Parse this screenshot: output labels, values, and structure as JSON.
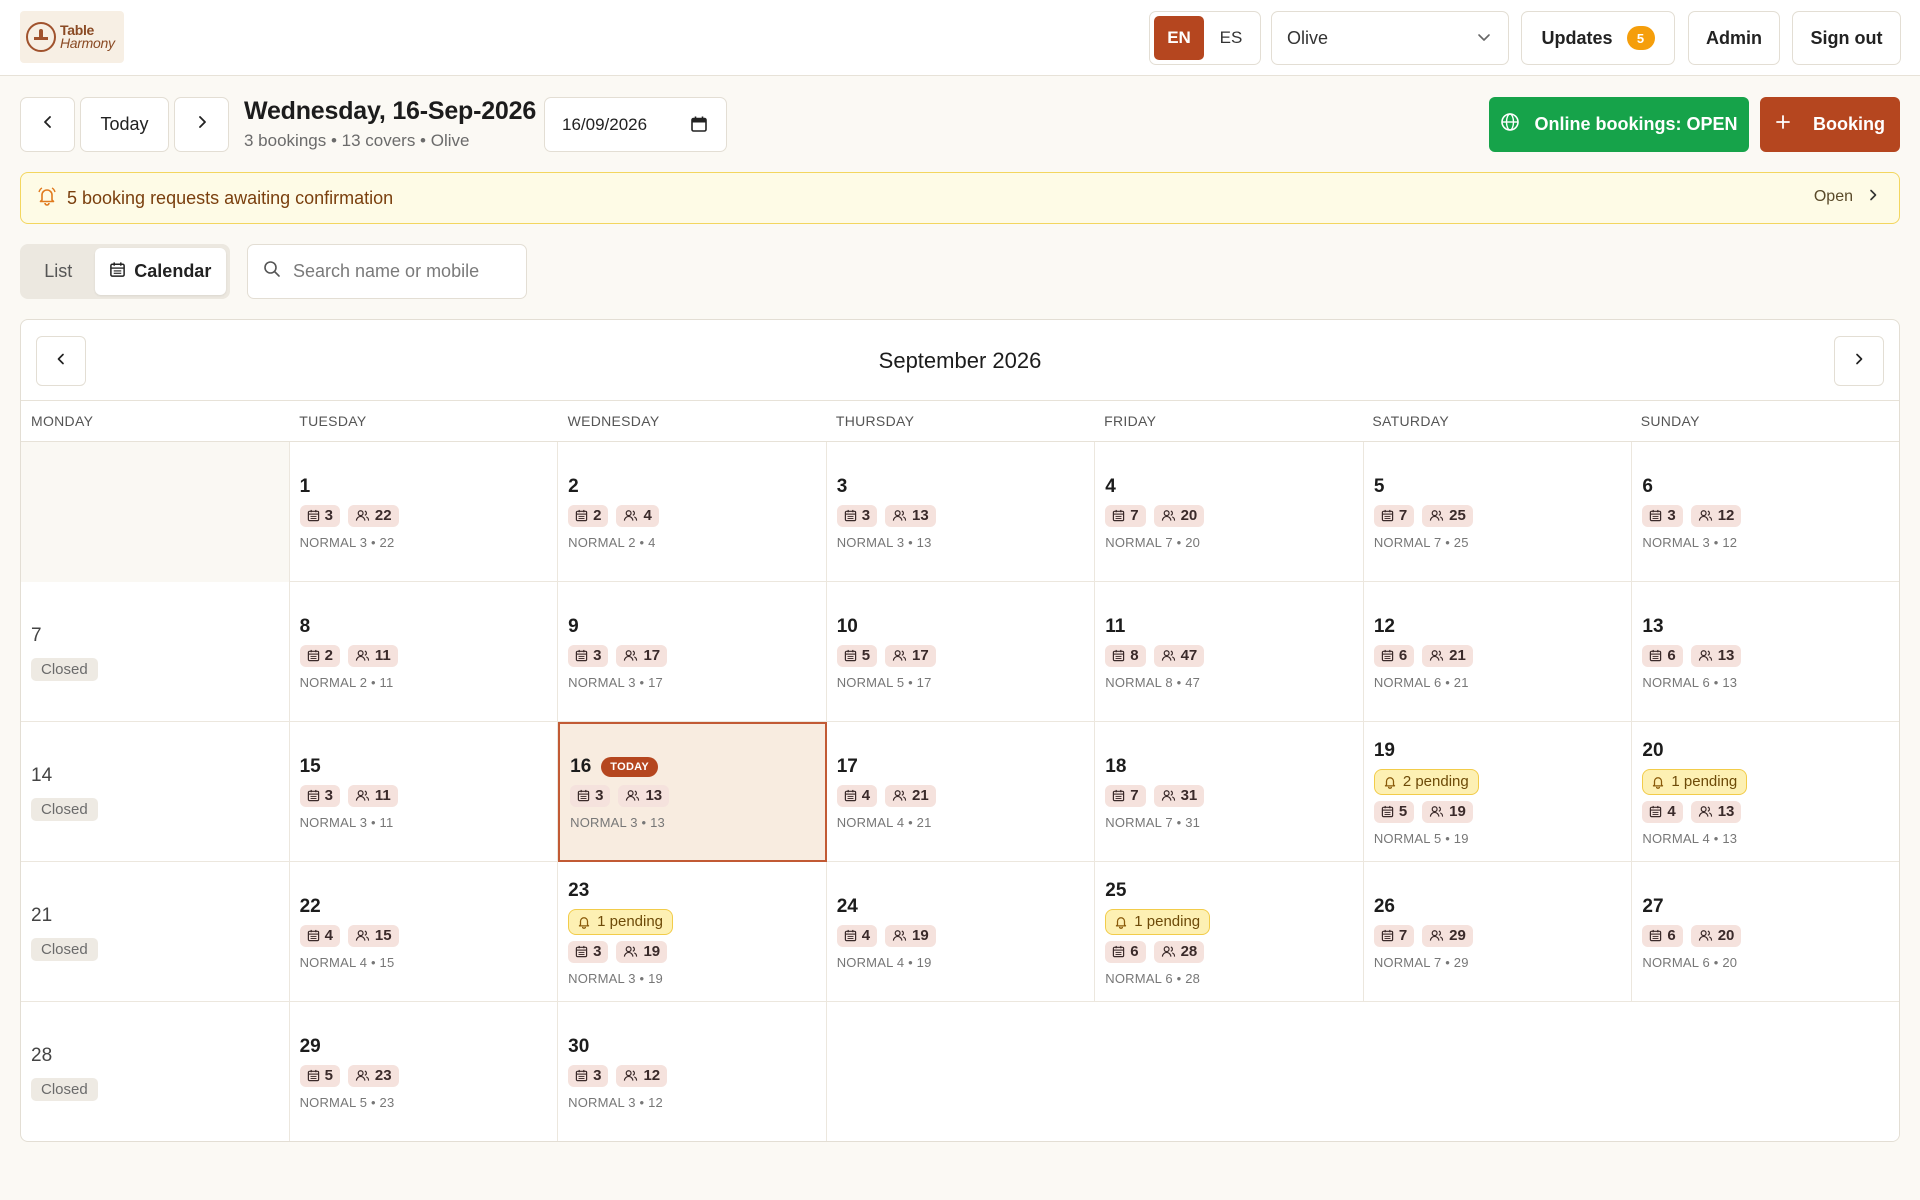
{
  "header": {
    "logo_line1": "Table",
    "logo_line2": "Harmony",
    "lang_en": "EN",
    "lang_es": "ES",
    "venue": "Olive",
    "updates_label": "Updates",
    "updates_count": "5",
    "admin_label": "Admin",
    "signout_label": "Sign out"
  },
  "toolbar": {
    "today_label": "Today",
    "date_title": "Wednesday, 16-Sep-2026",
    "date_sub": "3 bookings • 13 covers • Olive",
    "date_value": "16/09/2026",
    "online_label": "Online bookings: OPEN",
    "booking_label": "Booking"
  },
  "alert": {
    "text": "5 booking requests awaiting confirmation",
    "open_label": "Open"
  },
  "view": {
    "list_label": "List",
    "calendar_label": "Calendar",
    "search_placeholder": "Search name or mobile"
  },
  "calendar": {
    "month_title": "September 2026",
    "today_badge": "TODAY",
    "weekdays": [
      "MONDAY",
      "TUESDAY",
      "WEDNESDAY",
      "THURSDAY",
      "FRIDAY",
      "SATURDAY",
      "SUNDAY"
    ],
    "weeks": [
      [
        {
          "type": "empty"
        },
        {
          "num": "1",
          "b": "3",
          "c": "22",
          "normal": "NORMAL 3 • 22"
        },
        {
          "num": "2",
          "b": "2",
          "c": "4",
          "normal": "NORMAL 2 • 4"
        },
        {
          "num": "3",
          "b": "3",
          "c": "13",
          "normal": "NORMAL 3 • 13"
        },
        {
          "num": "4",
          "b": "7",
          "c": "20",
          "normal": "NORMAL 7 • 20"
        },
        {
          "num": "5",
          "b": "7",
          "c": "25",
          "normal": "NORMAL 7 • 25"
        },
        {
          "num": "6",
          "b": "3",
          "c": "12",
          "normal": "NORMAL 3 • 12"
        }
      ],
      [
        {
          "num": "7",
          "closed": "Closed"
        },
        {
          "num": "8",
          "b": "2",
          "c": "11",
          "normal": "NORMAL 2 • 11"
        },
        {
          "num": "9",
          "b": "3",
          "c": "17",
          "normal": "NORMAL 3 • 17"
        },
        {
          "num": "10",
          "b": "5",
          "c": "17",
          "normal": "NORMAL 5 • 17"
        },
        {
          "num": "11",
          "b": "8",
          "c": "47",
          "normal": "NORMAL 8 • 47"
        },
        {
          "num": "12",
          "b": "6",
          "c": "21",
          "normal": "NORMAL 6 • 21"
        },
        {
          "num": "13",
          "b": "6",
          "c": "13",
          "normal": "NORMAL 6 • 13"
        }
      ],
      [
        {
          "num": "14",
          "closed": "Closed"
        },
        {
          "num": "15",
          "b": "3",
          "c": "11",
          "normal": "NORMAL 3 • 11"
        },
        {
          "num": "16",
          "b": "3",
          "c": "13",
          "normal": "NORMAL 3 • 13",
          "today": true
        },
        {
          "num": "17",
          "b": "4",
          "c": "21",
          "normal": "NORMAL 4 • 21"
        },
        {
          "num": "18",
          "b": "7",
          "c": "31",
          "normal": "NORMAL 7 • 31"
        },
        {
          "num": "19",
          "pending": "2 pending",
          "b": "5",
          "c": "19",
          "normal": "NORMAL 5 • 19"
        },
        {
          "num": "20",
          "pending": "1 pending",
          "b": "4",
          "c": "13",
          "normal": "NORMAL 4 • 13"
        }
      ],
      [
        {
          "num": "21",
          "closed": "Closed"
        },
        {
          "num": "22",
          "b": "4",
          "c": "15",
          "normal": "NORMAL 4 • 15"
        },
        {
          "num": "23",
          "pending": "1 pending",
          "b": "3",
          "c": "19",
          "normal": "NORMAL 3 • 19"
        },
        {
          "num": "24",
          "b": "4",
          "c": "19",
          "normal": "NORMAL 4 • 19"
        },
        {
          "num": "25",
          "pending": "1 pending",
          "b": "6",
          "c": "28",
          "normal": "NORMAL 6 • 28"
        },
        {
          "num": "26",
          "b": "7",
          "c": "29",
          "normal": "NORMAL 7 • 29"
        },
        {
          "num": "27",
          "b": "6",
          "c": "20",
          "normal": "NORMAL 6 • 20"
        }
      ],
      [
        {
          "num": "28",
          "closed": "Closed"
        },
        {
          "num": "29",
          "b": "5",
          "c": "23",
          "normal": "NORMAL 5 • 23"
        },
        {
          "num": "30",
          "b": "3",
          "c": "12",
          "normal": "NORMAL 3 • 12"
        },
        {
          "type": "blank"
        },
        {
          "type": "blank"
        },
        {
          "type": "blank"
        },
        {
          "type": "blank"
        }
      ]
    ]
  },
  "colors": {
    "brand": "#b5461f",
    "online_green": "#16a34a",
    "updates_badge": "#f59e0b",
    "alert_bg": "#fefbe6",
    "today_bg": "#f8ece0"
  },
  "icons": {
    "prev": "chevron-left-icon",
    "next": "chevron-right-icon",
    "venue_dropdown": "chevron-down-icon",
    "date_picker": "calendar-icon",
    "online": "globe-icon",
    "booking": "plus-icon",
    "alert": "bell-icon",
    "search": "search-icon",
    "bookings_stat": "calendar-icon",
    "covers_stat": "users-icon"
  }
}
